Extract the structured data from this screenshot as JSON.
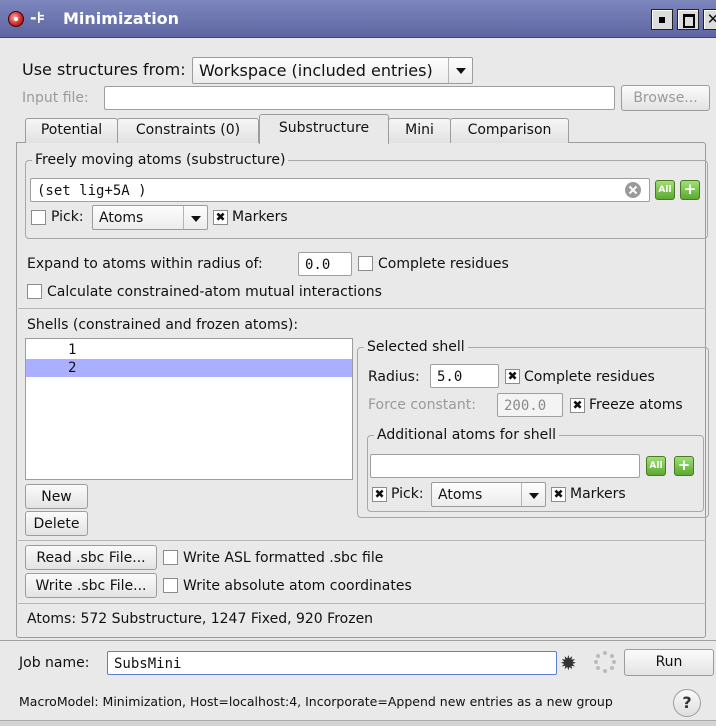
{
  "window": {
    "title": "Minimization",
    "pin_glyph": "-⊧",
    "close_glyph": "✕"
  },
  "source": {
    "use_label": "Use structures from:",
    "use_value": "Workspace (included entries)",
    "input_file_label": "Input file:",
    "input_file_value": "",
    "browse_label": "Browse..."
  },
  "tabs": [
    {
      "label": "Potential",
      "active": false
    },
    {
      "label": "Constraints (0)",
      "active": false
    },
    {
      "label": "Substructure",
      "active": true
    },
    {
      "label": "Mini",
      "active": false
    },
    {
      "label": "Comparison",
      "active": false
    }
  ],
  "substructure": {
    "group_title": "Freely moving atoms (substructure)",
    "asl_value": "(set lig+5A )",
    "all_label": "All",
    "plus_label": "+",
    "pick_label": "Pick:",
    "pick_checked": false,
    "pick_value": "Atoms",
    "markers_label": "Markers",
    "markers_checked": true,
    "expand_label": "Expand to atoms within radius of:",
    "expand_value": "0.0",
    "complete_residues_label": "Complete residues",
    "complete_residues_checked": false,
    "calc_label": "Calculate constrained-atom mutual interactions",
    "calc_checked": false,
    "shells_label": "Shells (constrained and frozen atoms):",
    "shells": [
      {
        "label": "1",
        "selected": false
      },
      {
        "label": "2",
        "selected": true
      }
    ],
    "new_label": "New",
    "delete_label": "Delete",
    "selected_shell": {
      "group_title": "Selected shell",
      "radius_label": "Radius:",
      "radius_value": "5.0",
      "complete_residues_label": "Complete residues",
      "complete_residues_checked": true,
      "force_label": "Force constant:",
      "force_value": "200.0",
      "freeze_label": "Freeze atoms",
      "freeze_checked": true,
      "additional_title": "Additional atoms for shell",
      "additional_value": "",
      "all_label": "All",
      "plus_label": "+",
      "pick_label": "Pick:",
      "pick_checked": true,
      "pick_value": "Atoms",
      "markers_label": "Markers",
      "markers_checked": true
    },
    "read_sbc_label": "Read .sbc File...",
    "write_asl_label": "Write ASL formatted .sbc file",
    "write_asl_checked": false,
    "write_sbc_label": "Write .sbc File...",
    "write_abs_label": "Write absolute atom coordinates",
    "write_abs_checked": false,
    "atoms_summary": "Atoms: 572 Substructure, 1247 Fixed, 920 Frozen"
  },
  "job": {
    "name_label": "Job name:",
    "name_value": "SubsMini",
    "run_label": "Run",
    "status": "MacroModel: Minimization, Host=localhost:4, Incorporate=Append new entries as a new group",
    "help_label": "?"
  },
  "icons": {
    "app": "app-icon",
    "pin": "pin-icon",
    "clear": "clear-icon",
    "gear": "gear-icon",
    "spinner": "spinner-icon",
    "help": "help-icon"
  },
  "colors": {
    "titlebar": "#6a73ad",
    "selection": "#aab0ff",
    "green_button": "#5ca831"
  }
}
